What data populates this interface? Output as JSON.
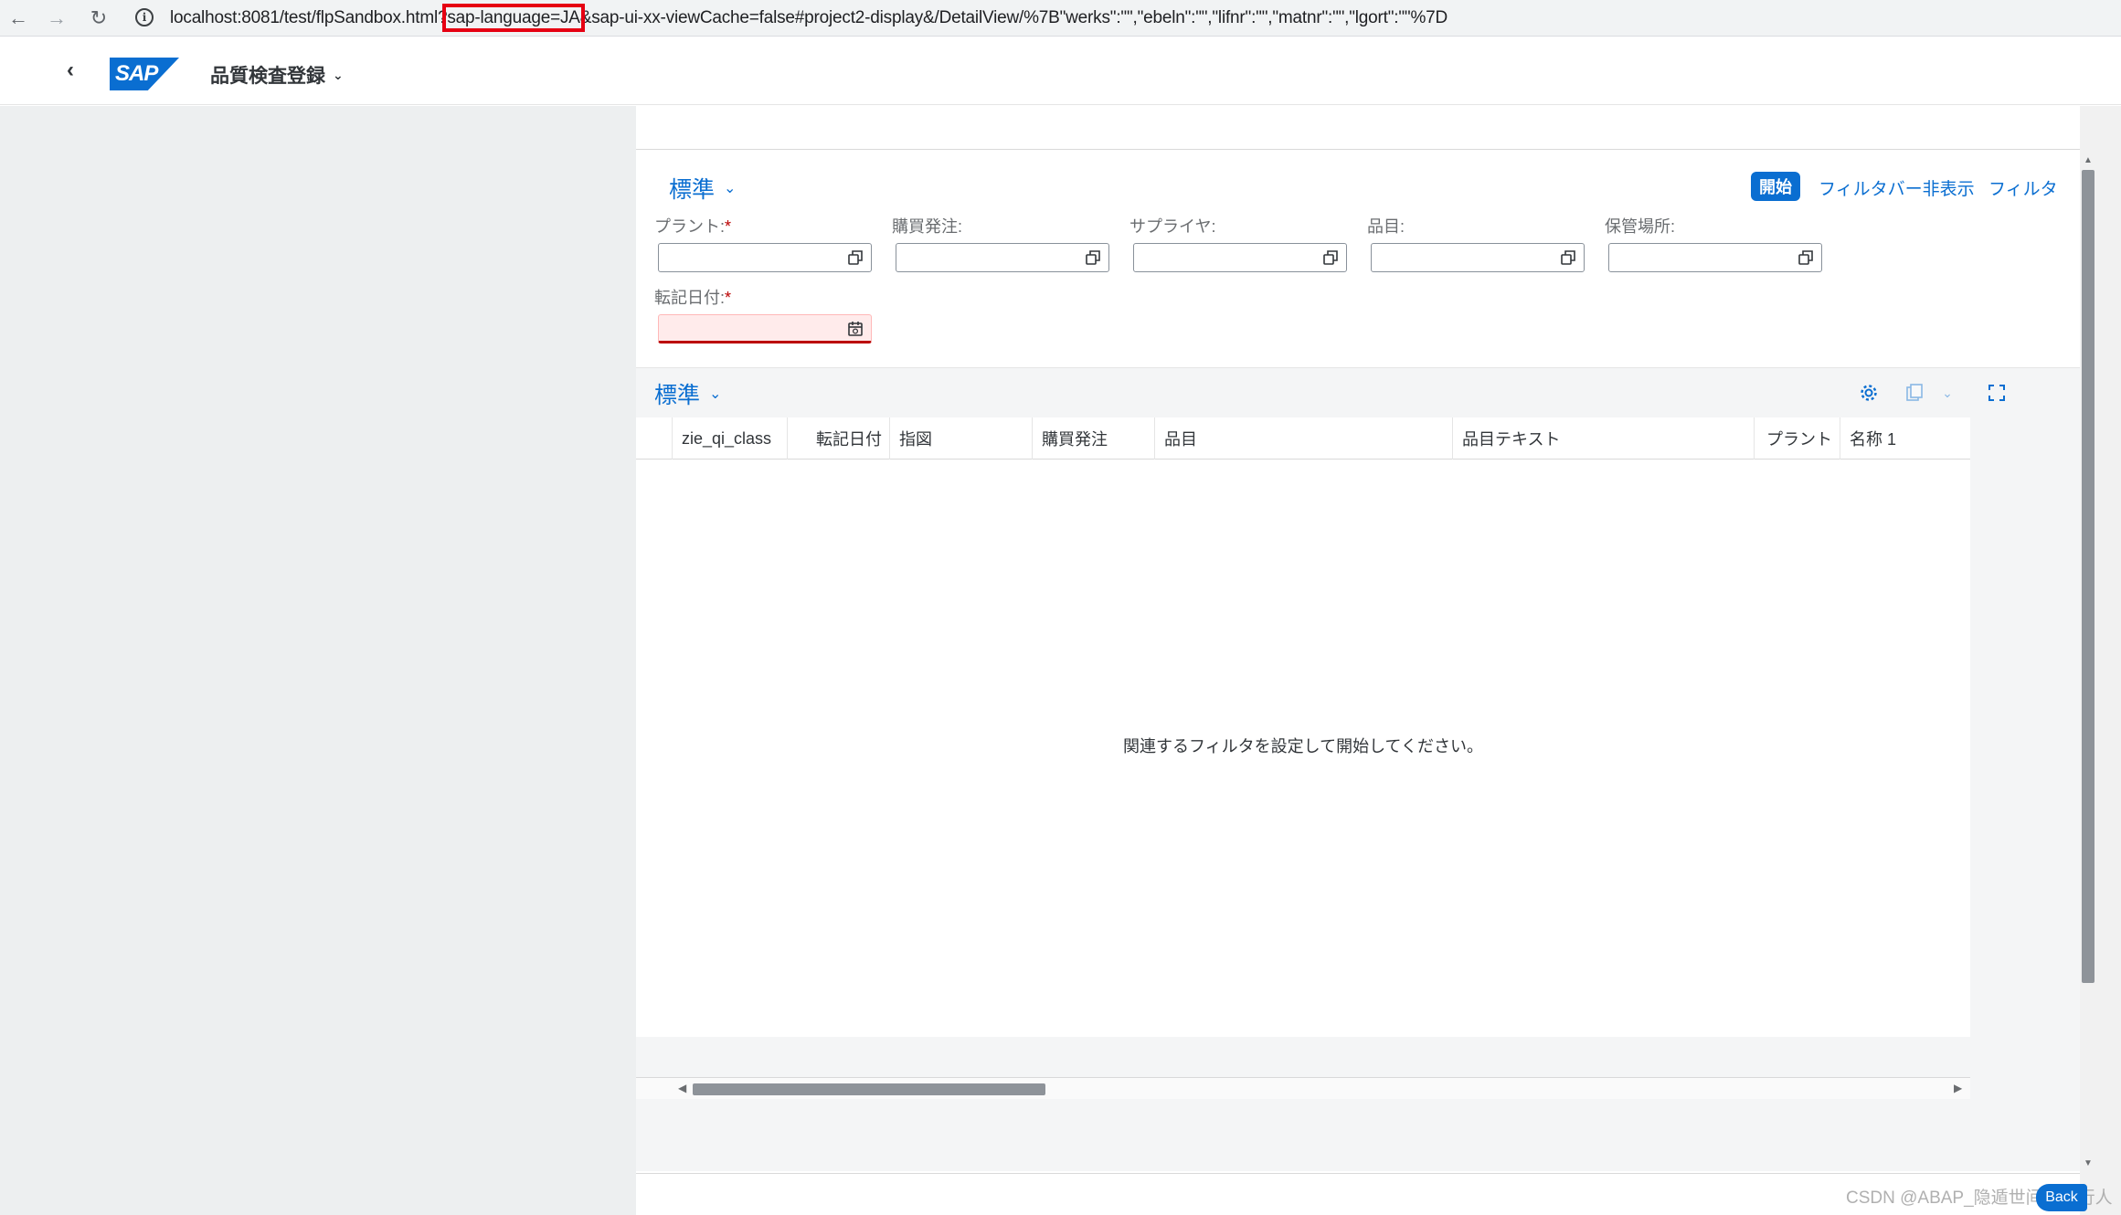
{
  "browser": {
    "url_before": "localhost:8081/test/flpSandbox.html?",
    "url_highlight": "sap-language=JA",
    "url_after": "&sap-ui-xx-viewCache=false#project2-display&/DetailView/%7B\"werks\":\"\",\"ebeln\":\"\",\"lifnr\":\"\",\"matnr\":\"\",\"lgort\":\"\"%7D",
    "back_icon": "arrow-left-icon",
    "forward_icon": "arrow-right-icon",
    "reload_icon": "reload-icon"
  },
  "shell": {
    "logo_text": "SAP",
    "app_title": "品質検査登録"
  },
  "filter_bar": {
    "variant_label": "標準",
    "start_button": "開始",
    "hide_filter_bar": "フィルタバー非表示",
    "filters_link": "フィルタ",
    "fields": [
      {
        "label": "プラント:",
        "required": true,
        "value": ""
      },
      {
        "label": "購買発注:",
        "required": false,
        "value": ""
      },
      {
        "label": "サプライヤ:",
        "required": false,
        "value": ""
      },
      {
        "label": "品目:",
        "required": false,
        "value": ""
      },
      {
        "label": "保管場所:",
        "required": false,
        "value": ""
      },
      {
        "label": "転記日付:",
        "required": true,
        "value": "",
        "error": true
      }
    ],
    "required_mark": "*"
  },
  "table": {
    "variant_label": "標準",
    "columns": [
      "zie_qi_class",
      "転記日付",
      "指図",
      "購買発注",
      "品目",
      "品目テキスト",
      "プラント",
      "名称 1"
    ],
    "empty_message": "関連するフィルタを設定して開始してください。"
  },
  "watermark": "CSDN @ABAP_隐遁世间的旅行人",
  "back_chip": "Back",
  "colors": {
    "accent": "#0a6ed1",
    "error": "#bb0000",
    "highlight_box": "#e60012"
  }
}
